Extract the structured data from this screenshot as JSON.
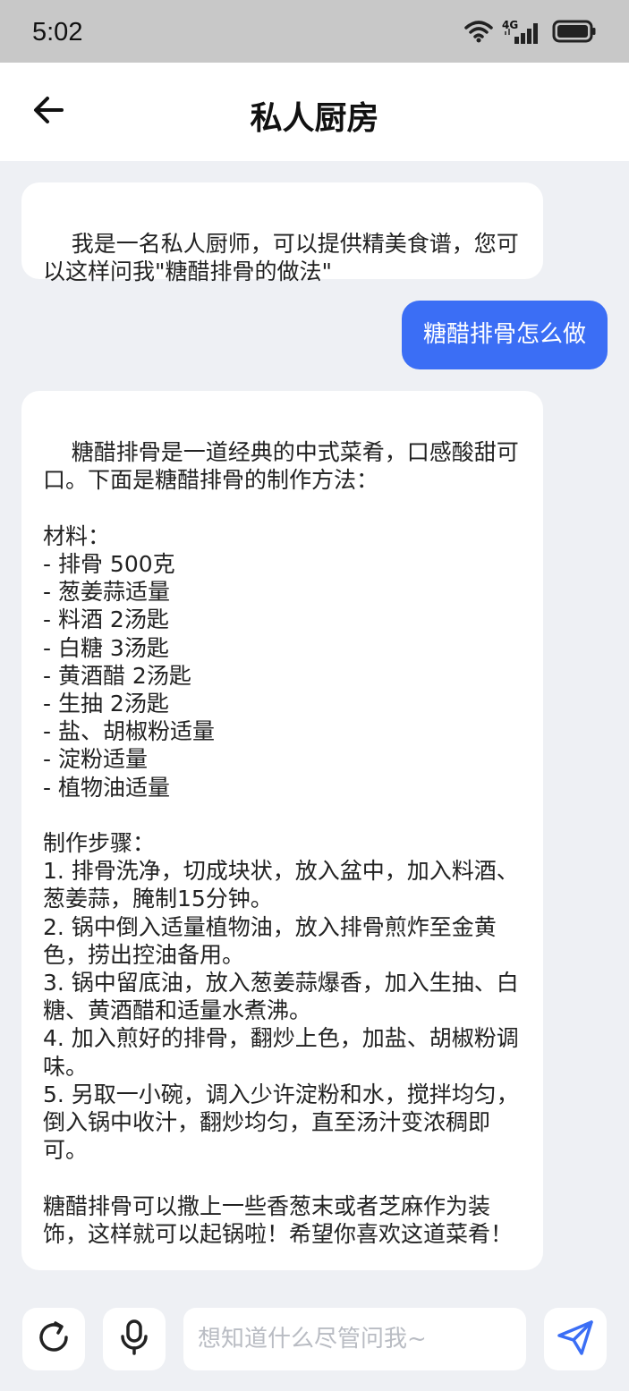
{
  "status_bar": {
    "time": "5:02",
    "network_label": "4G",
    "icons": [
      "wifi-icon",
      "signal-icon",
      "battery-icon"
    ]
  },
  "header": {
    "title": "私人厨房",
    "back_icon": "arrow-left-icon"
  },
  "messages": [
    {
      "role": "assistant",
      "text": "我是一名私人厨师，可以提供精美食谱，您可以这样问我\"糖醋排骨的做法\""
    },
    {
      "role": "user",
      "text": "糖醋排骨怎么做"
    },
    {
      "role": "assistant",
      "text": "糖醋排骨是一道经典的中式菜肴，口感酸甜可口。下面是糖醋排骨的制作方法：\n\n材料：\n- 排骨 500克\n- 葱姜蒜适量\n- 料酒 2汤匙\n- 白糖 3汤匙\n- 黄酒醋 2汤匙\n- 生抽 2汤匙\n- 盐、胡椒粉适量\n- 淀粉适量\n- 植物油适量\n\n制作步骤：\n1. 排骨洗净，切成块状，放入盆中，加入料酒、葱姜蒜，腌制15分钟。\n2. 锅中倒入适量植物油，放入排骨煎炸至金黄色，捞出控油备用。\n3. 锅中留底油，放入葱姜蒜爆香，加入生抽、白糖、黄酒醋和适量水煮沸。\n4. 加入煎好的排骨，翻炒上色，加盐、胡椒粉调味。\n5. 另取一小碗，调入少许淀粉和水，搅拌均匀，倒入锅中收汁，翻炒均匀，直至汤汁变浓稠即可。\n\n糖醋排骨可以撒上一些香葱末或者芝麻作为装饰，这样就可以起锅啦！希望你喜欢这道菜肴！"
    }
  ],
  "input_bar": {
    "placeholder": "想知道什么尽管问我~",
    "value": "",
    "refresh_icon": "refresh-icon",
    "mic_icon": "microphone-icon",
    "send_icon": "send-icon"
  },
  "colors": {
    "accent": "#3b6ef5",
    "background": "#eef0f4",
    "status_bar": "#c8c8c8"
  }
}
